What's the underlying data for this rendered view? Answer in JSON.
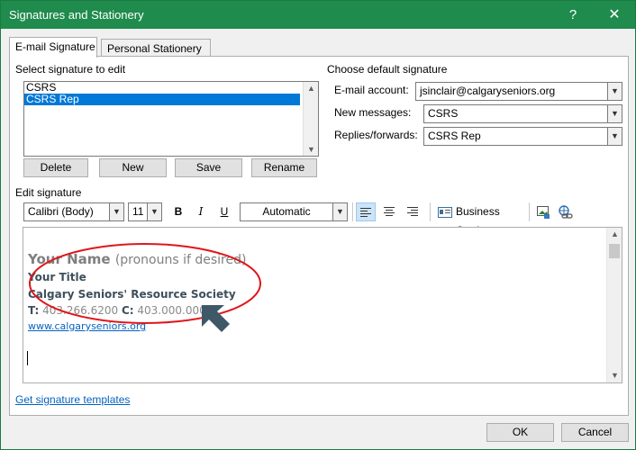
{
  "window": {
    "title": "Signatures and Stationery",
    "help": "?",
    "close": "✕"
  },
  "tabs": [
    {
      "label": "E-mail Signature",
      "active": true
    },
    {
      "label": "Personal Stationery",
      "active": false
    }
  ],
  "select_signature": {
    "label": "Select signature to edit",
    "items": [
      "CSRS",
      "CSRS Rep"
    ],
    "selected": "CSRS Rep"
  },
  "buttons": {
    "delete": "Delete",
    "new": "New",
    "save": "Save",
    "rename": "Rename"
  },
  "default_signature": {
    "label": "Choose default signature",
    "email_account_label": "E-mail account:",
    "email_account_value": "jsinclair@calgaryseniors.org",
    "new_messages_label": "New messages:",
    "new_messages_value": "CSRS",
    "replies_label": "Replies/forwards:",
    "replies_value": "CSRS Rep"
  },
  "edit_signature": {
    "label": "Edit signature",
    "font": "Calibri (Body)",
    "size": "11",
    "bold": "B",
    "italic": "I",
    "underline": "U",
    "color": "Automatic",
    "business_card": "Business Card"
  },
  "signature": {
    "name": "Your Name",
    "pronouns": "(pronouns if desired)",
    "title": "Your Title",
    "org": "Calgary Seniors' Resource Society",
    "phone_t_label": "T:",
    "phone_t": "403.266.6200",
    "phone_c_label": "C:",
    "phone_c": "403.000.0000",
    "website": "www.calgaryseniors.org"
  },
  "annotation": {
    "color": "#e0161b",
    "arrow_color": "#3e5868"
  },
  "templates_link": "Get signature templates",
  "footer": {
    "ok": "OK",
    "cancel": "Cancel"
  },
  "colors": {
    "title_bar": "#1f8b4c",
    "selection": "#0078d7",
    "link": "#0563c1"
  }
}
